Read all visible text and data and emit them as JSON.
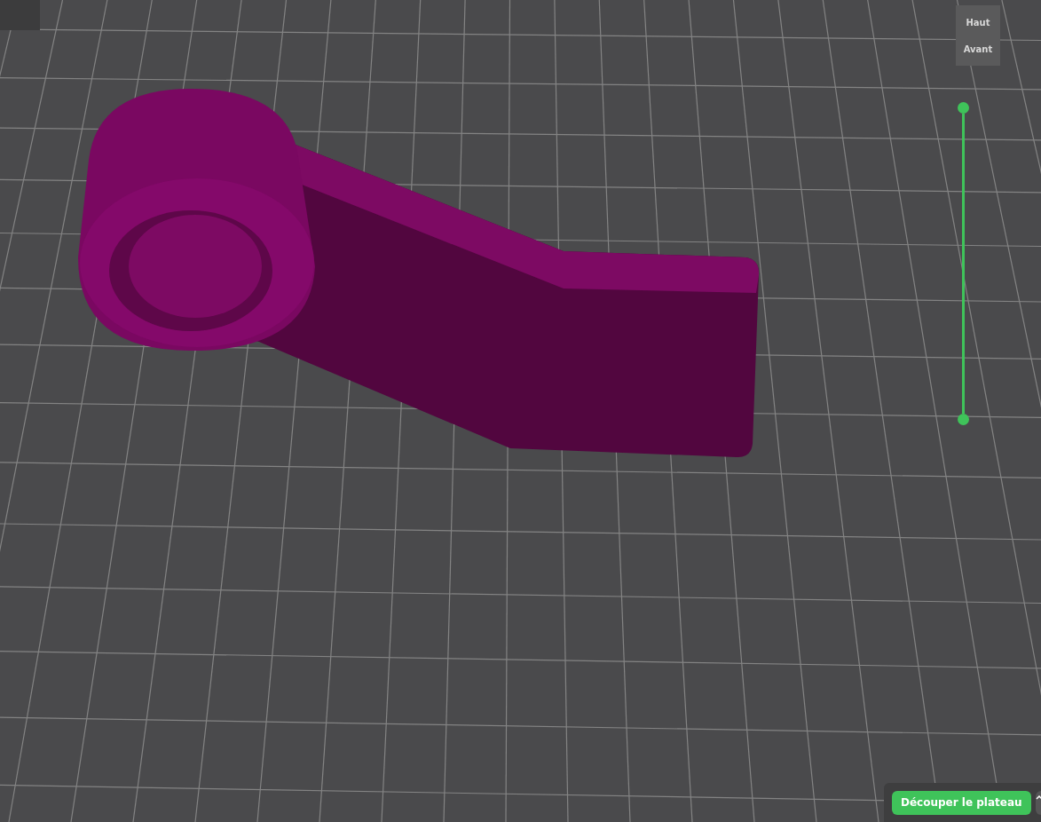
{
  "view_cube": {
    "faces": [
      "Haut",
      "Avant"
    ]
  },
  "slice_button": {
    "label": "Découper le plateau"
  }
}
